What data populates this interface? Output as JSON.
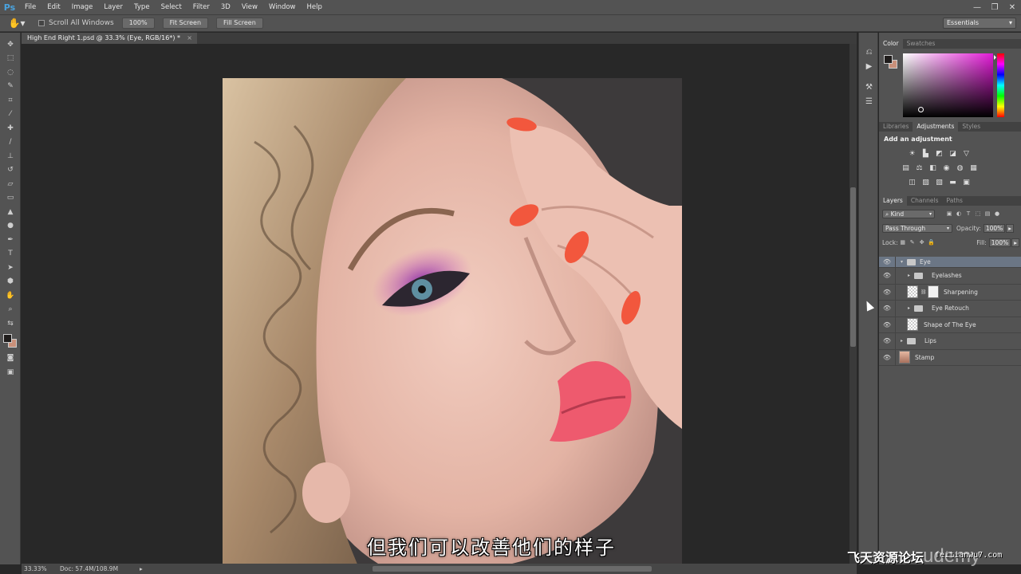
{
  "app": {
    "logo": "Ps"
  },
  "menu": [
    "File",
    "Edit",
    "Image",
    "Layer",
    "Type",
    "Select",
    "Filter",
    "3D",
    "View",
    "Window",
    "Help"
  ],
  "window_controls": [
    "—",
    "❐",
    "✕"
  ],
  "options_bar": {
    "scroll_all_windows": "Scroll All Windows",
    "zoom_100": "100%",
    "fit_screen": "Fit Screen",
    "fill_screen": "Fill Screen",
    "workspace": "Essentials"
  },
  "document": {
    "tab_title": "High End Right 1.psd @ 33.3% (Eye, RGB/16*) *",
    "close": "×"
  },
  "status": {
    "zoom": "33.33%",
    "doc": "Doc: 57.4M/108.9M",
    "arrow": "▸"
  },
  "colors": {
    "foreground": "#1f1c1b",
    "background": "#c9907a",
    "accent": "#6b7685"
  },
  "panels": {
    "color_tabs": [
      "Color",
      "Swatches"
    ],
    "adjust_tabs": [
      "Libraries",
      "Adjustments",
      "Styles"
    ],
    "adjust_title": "Add an adjustment",
    "layers_tabs": [
      "Layers",
      "Channels",
      "Paths"
    ],
    "kind": "Kind",
    "blend_mode": "Pass Through",
    "opacity_label": "Opacity:",
    "opacity_value": "100%",
    "lock_label": "Lock:",
    "fill_label": "Fill:",
    "fill_value": "100%"
  },
  "layers": [
    {
      "name": "Eye",
      "type": "group-open",
      "indent": 0,
      "selected": true
    },
    {
      "name": "Eyelashes",
      "type": "group",
      "indent": 1
    },
    {
      "name": "Sharpening",
      "type": "masked",
      "indent": 1
    },
    {
      "name": "Eye Retouch",
      "type": "group",
      "indent": 1
    },
    {
      "name": "Shape of The Eye",
      "type": "pixel",
      "indent": 1
    },
    {
      "name": "Lips",
      "type": "group",
      "indent": 0
    },
    {
      "name": "Stamp",
      "type": "image",
      "indent": 0
    }
  ],
  "subtitle": "但我们可以改善他们的样子",
  "watermark": {
    "text": "飞天资源论坛",
    "brand": "udemy",
    "url": "feitianwu7.com"
  }
}
